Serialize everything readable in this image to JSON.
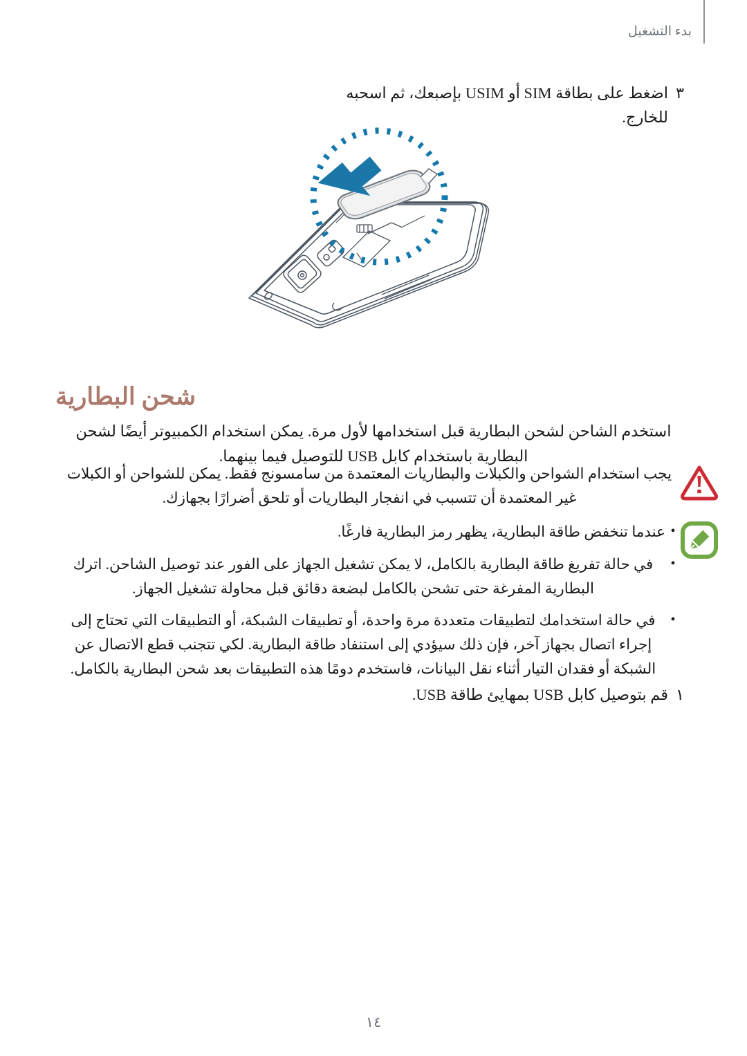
{
  "page": {
    "header_title": "بدء التشغيل",
    "folio": "١٤",
    "header_color": "#6e757b"
  },
  "steps": {
    "three": {
      "number": "٣",
      "text": "اضغط على بطاقة SIM أو USIM بإصبعك، ثم اسحبه للخارج."
    },
    "one": {
      "number": "١",
      "text": "قم بتوصيل كابل USB بمهايئ طاقة USB."
    }
  },
  "figure": {
    "caption_alt": "إزالة بطاقة SIM من الهاتف",
    "magnifier_color": "#1478ac",
    "arrow_color": "#1b77a8",
    "outline_color": "#4a5560",
    "tray_fill": "#e3e4e6"
  },
  "section": {
    "heading": "شحن البطارية",
    "heading_color": "#ac7a6d",
    "paragraph": "استخدم الشاحن لشحن البطارية قبل استخدامها لأول مرة. يمكن استخدام الكمبيوتر أيضًا لشحن البطارية باستخدام كابل USB للتوصيل فيما بينهما."
  },
  "warning": {
    "icon": "warning-triangle-icon",
    "icon_color": "#cc2b34",
    "text": "يجب استخدام الشواحن والكبلات والبطاريات المعتمدة من سامسونج فقط. يمكن للشواحن أو الكبلات غير المعتمدة أن تتسبب في انفجار البطاريات أو تلحق أضرارًا بجهازك."
  },
  "note": {
    "icon": "note-pencil-icon",
    "icon_color": "#6fa844",
    "bullet": "•",
    "items": [
      "عندما تنخفض طاقة البطارية، يظهر رمز البطارية فارغًا.",
      "في حالة تفريغ طاقة البطارية بالكامل، لا يمكن تشغيل الجهاز على الفور عند توصيل الشاحن. اترك البطارية المفرغة حتى تشحن بالكامل لبضعة دقائق قبل محاولة تشغيل الجهاز.",
      "في حالة استخدامك لتطبيقات متعددة مرة واحدة، أو تطبيقات الشبكة، أو التطبيقات التي تحتاج إلى إجراء اتصال بجهاز آخر، فإن ذلك سيؤدي إلى استنفاد طاقة البطارية. لكي تتجنب قطع الاتصال عن الشبكة أو فقدان التيار أثناء نقل البيانات، فاستخدم دومًا هذه التطبيقات بعد شحن البطارية بالكامل."
    ]
  }
}
